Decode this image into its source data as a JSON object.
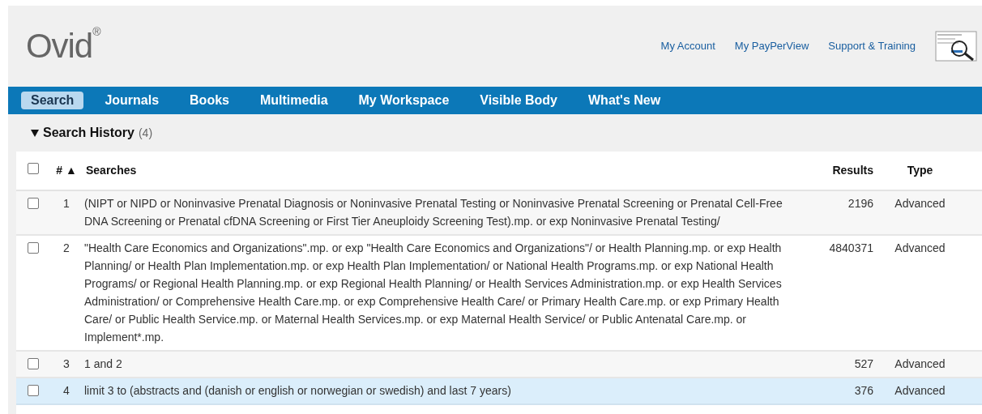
{
  "logo": "Ovid$^{®}$",
  "top_links": [
    "My Account",
    "My PayPerView",
    "Support & Training"
  ],
  "nav": [
    {
      "label": "Search",
      "selected": true
    },
    {
      "label": "Journals",
      "selected": false
    },
    {
      "label": "Books",
      "selected": false
    },
    {
      "label": "Multimedia",
      "selected": false
    },
    {
      "label": "My Workspace",
      "selected": false
    },
    {
      "label": "Visible Body",
      "selected": false
    },
    {
      "label": "What's New",
      "selected": false
    }
  ],
  "section": {
    "title": "Search History",
    "count": "(4)",
    "expanded": true
  },
  "table": {
    "header_checked": false,
    "columns": [
      "# ▲",
      "Searches",
      "Results",
      "Type"
    ],
    "rows": [
      {
        "number": "1",
        "search": "(NIPT or NIPD or Noninvasive Prenatal Diagnosis or Noninvasive Prenatal Testing or Noninvasive Prenatal Screening or Prenatal Cell-Free DNA Screening or Prenatal cfDNA Screening or First Tier Aneuploidy Screening Test).mp. or exp Noninvasive Prenatal Testing/",
        "results": "2196",
        "type": "Advanced",
        "checked": false,
        "selected": false
      },
      {
        "number": "2",
        "search": "\"Health Care Economics and Organizations\".mp. or exp \"Health Care Economics and Organizations\"/ or Health Planning.mp. or exp Health Planning/ or Health Plan Implementation.mp. or exp Health Plan Implementation/ or National Health Programs.mp. or exp National Health Programs/ or Regional Health Planning.mp. or exp Regional Health Planning/ or Health Services Administration.mp. or exp Health Services Administration/ or Comprehensive Health Care.mp. or exp Comprehensive Health Care/ or Primary Health Care.mp. or exp Primary Health Care/ or Public Health Service.mp. or Maternal Health Services.mp. or exp Maternal Health Service/ or Public Antenatal Care.mp. or Implement*.mp.",
        "results": "4840371",
        "type": "Advanced",
        "checked": false,
        "selected": false
      },
      {
        "number": "3",
        "search": "1 and 2",
        "results": "527",
        "type": "Advanced",
        "checked": false,
        "selected": false
      },
      {
        "number": "4",
        "search": "limit 3 to (abstracts and (danish or english or norwegian or swedish) and last 7 years)",
        "results": "376",
        "type": "Advanced",
        "checked": false,
        "selected": true
      }
    ]
  }
}
